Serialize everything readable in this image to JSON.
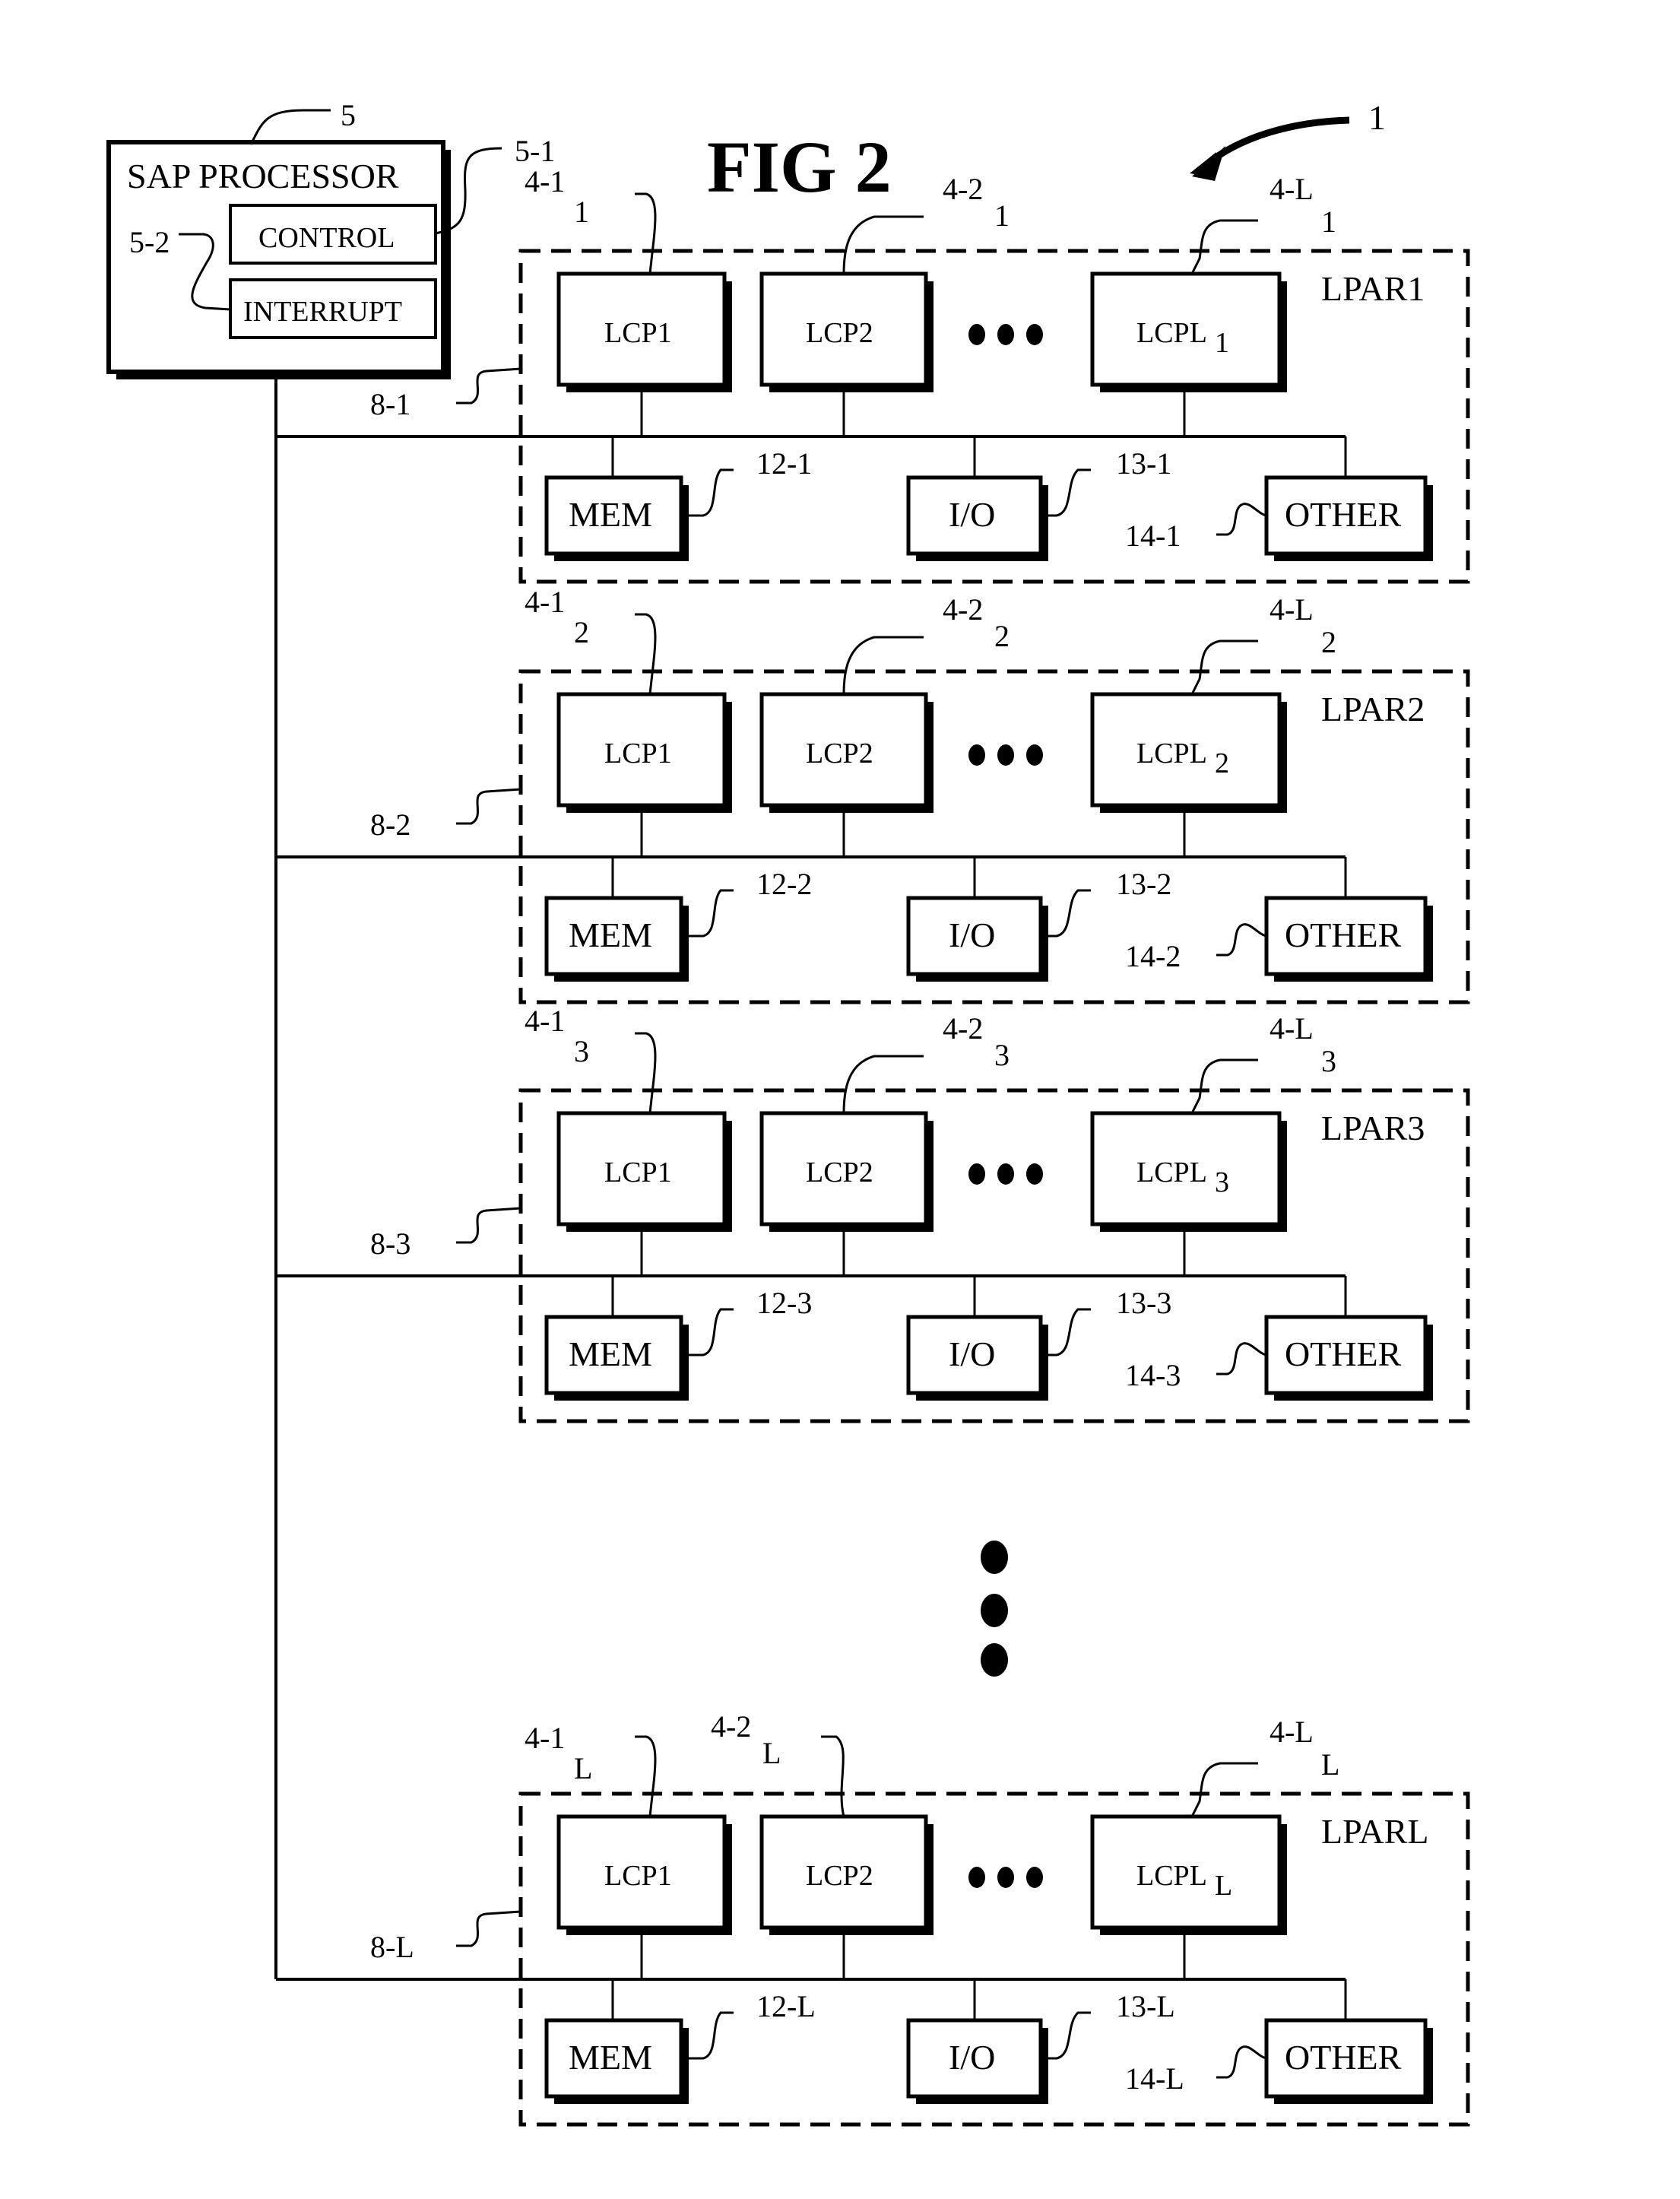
{
  "figure": {
    "title": "FIG 2",
    "system_ref": "1"
  },
  "sap": {
    "label": "SAP PROCESSOR",
    "ref": "5",
    "control_label": "CONTROL",
    "control_ref": "5-1",
    "interrupt_label": "INTERRUPT",
    "interrupt_ref": "5-2"
  },
  "partitions": [
    {
      "name": "LPAR1",
      "sub": "1",
      "link_ref": "8-1",
      "lcp1": "LCP1",
      "lcp2": "LCP2",
      "lcpl": "LCPL",
      "lcpl_sub": "1",
      "lcp1_ref": "4-1",
      "lcp2_ref": "4-2",
      "lcpl_ref": "4-L",
      "mem": "MEM",
      "io": "I/O",
      "other": "OTHER",
      "mem_ref": "12-1",
      "io_ref": "13-1",
      "other_ref": "14-1"
    },
    {
      "name": "LPAR2",
      "sub": "2",
      "link_ref": "8-2",
      "lcp1": "LCP1",
      "lcp2": "LCP2",
      "lcpl": "LCPL",
      "lcpl_sub": "2",
      "lcp1_ref": "4-1",
      "lcp2_ref": "4-2",
      "lcpl_ref": "4-L",
      "mem": "MEM",
      "io": "I/O",
      "other": "OTHER",
      "mem_ref": "12-2",
      "io_ref": "13-2",
      "other_ref": "14-2"
    },
    {
      "name": "LPAR3",
      "sub": "3",
      "link_ref": "8-3",
      "lcp1": "LCP1",
      "lcp2": "LCP2",
      "lcpl": "LCPL",
      "lcpl_sub": "3",
      "lcp1_ref": "4-1",
      "lcp2_ref": "4-2",
      "lcpl_ref": "4-L",
      "mem": "MEM",
      "io": "I/O",
      "other": "OTHER",
      "mem_ref": "12-3",
      "io_ref": "13-3",
      "other_ref": "14-3"
    },
    {
      "name": "LPARL",
      "sub": "L",
      "link_ref": "8-L",
      "lcp1": "LCP1",
      "lcp2": "LCP2",
      "lcpl": "LCPL",
      "lcpl_sub": "L",
      "lcp1_ref": "4-1",
      "lcp2_ref": "4-2",
      "lcpl_ref": "4-L",
      "mem": "MEM",
      "io": "I/O",
      "other": "OTHER",
      "mem_ref": "12-L",
      "io_ref": "13-L",
      "other_ref": "14-L"
    }
  ]
}
